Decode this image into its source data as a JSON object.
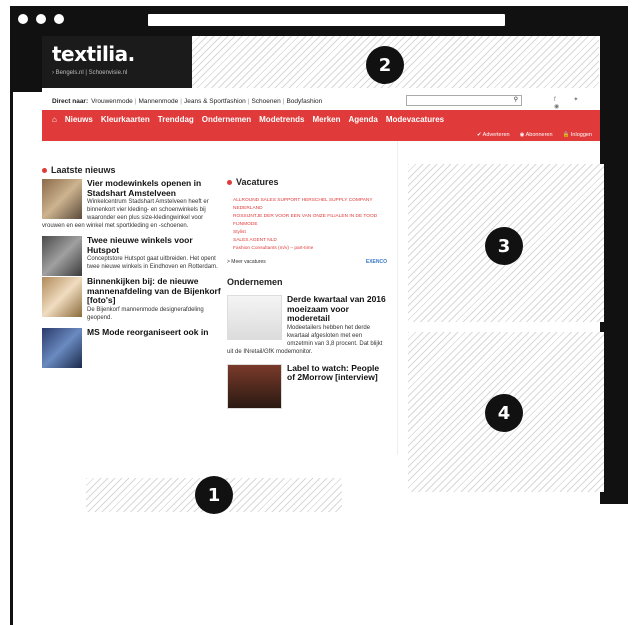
{
  "header": {
    "brand": "textilia.",
    "sub_links": "› Bengels.nl  |  Schoenvisie.nl"
  },
  "topbar": {
    "label": "Direct naar:",
    "links": [
      "Vrouwenmode",
      "Mannenmode",
      "Jeans & Sportfashion",
      "Schoenen",
      "Bodyfashion"
    ],
    "search_icon": "search-icon",
    "social_icons": "f  ✦  ◉"
  },
  "nav": {
    "home_icon": "home-icon",
    "items": [
      "Nieuws",
      "Kleurkaarten",
      "Trenddag",
      "Ondernemen",
      "Modetrends",
      "Merken",
      "Agenda",
      "Modevacatures"
    ],
    "sub": [
      "✔ Adverteren",
      "◉ Abonneren",
      "🔒 Inloggen"
    ]
  },
  "laatste": {
    "title": "Laatste nieuws",
    "items": [
      {
        "headline": "Vier modewinkels openen in Stadshart Amstelveen",
        "teaser": "Winkelcentrum Stadshart Amstelveen heeft er binnenkort vier kleding- en schoenwinkels bij waaronder een plus size-kledingwinkel voor vrouwen en een winkel met sportkleding en -schoenen."
      },
      {
        "headline": "Twee nieuwe winkels voor Hutspot",
        "teaser": "Conceptstore Hutspot gaat uitbreiden. Het opent twee nieuwe winkels in Eindhoven en Rotterdam."
      },
      {
        "headline": "Binnenkijken bij: de nieuwe mannenafdeling van de Bijenkorf [foto's]",
        "teaser": "De Bijenkorf mannenmode designerafdeling geopend."
      },
      {
        "headline": "MS Mode reorganiseert ook in",
        "teaser": ""
      }
    ]
  },
  "vacatures": {
    "title": "Vacatures",
    "items": [
      "ALLROUND SALES SUPPORT HERSCHEL SUPPLY COMPANY NEDERLAND",
      "ROSSIJNTJE DER VOOR EEN VAN ONZE FILIALEN IN DE TOOD FIJNMODE",
      "Stylist",
      "SALES AGENT NLD",
      "Fashion Consultants (m/v) – part-time"
    ],
    "more": "> Meer vacatures",
    "logo": "EXENCO"
  },
  "ondernemen": {
    "title": "Ondernemen",
    "items": [
      {
        "headline": "Derde kwartaal van 2016 moeizaam voor moderetail",
        "teaser": "Modeetailers hebben het derde kwartaal afgesloten met een omzetmin van 3,8 procent. Dat blijkt uit de INretail/GfK modemonitor."
      },
      {
        "headline": "Label to watch: People of 2Morrow [interview]",
        "teaser": ""
      }
    ]
  },
  "badges": [
    "1",
    "2",
    "3",
    "4"
  ]
}
